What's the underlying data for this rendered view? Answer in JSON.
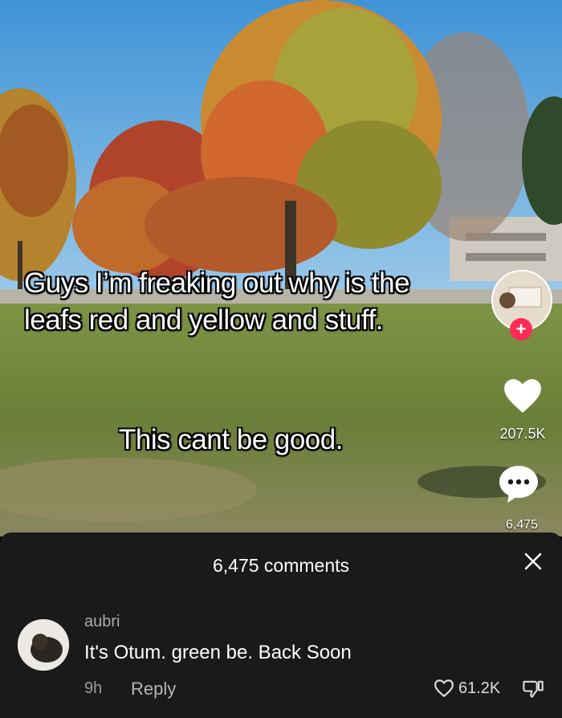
{
  "video": {
    "caption_line1": "Guys I’m freaking out why is the",
    "caption_line2": "leafs red and yellow and stuff.",
    "caption_line3": "This cant be good."
  },
  "sidebar": {
    "follow_symbol": "+",
    "like_count": "207.5K",
    "comment_count": "6,475"
  },
  "comments_panel": {
    "title": "6,475 comments",
    "close_icon": "close-icon",
    "comment": {
      "username": "aubri",
      "text": "It's Otum. green be. Back Soon",
      "time": "9h",
      "reply_label": "Reply",
      "like_count": "61.2K"
    }
  },
  "colors": {
    "panel_bg": "#1a1a1a",
    "follow_accent": "#fe2c55",
    "sky": "#4d9fdc",
    "grass": "#6f8a3a"
  }
}
